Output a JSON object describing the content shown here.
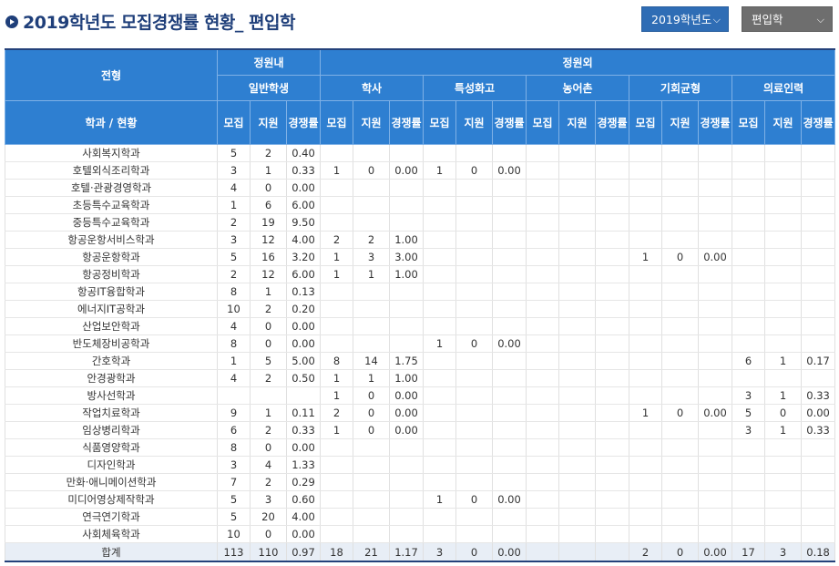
{
  "title": "2019학년도 모집경쟁률 현황_ 편입학",
  "year_select": {
    "value": "2019학년도"
  },
  "type_select": {
    "value": "편입학"
  },
  "header": {
    "jeonhyeong": "전형",
    "jeongwonnae": "정원내",
    "jeongwonoe": "정원외",
    "groups": [
      "일반학생",
      "학사",
      "특성화고",
      "농어촌",
      "기회균형",
      "의료인력"
    ],
    "dept_col": "학과 / 현황",
    "sub_mojip": "모집",
    "sub_jiwon": "지원",
    "sub_rate": "경쟁률"
  },
  "rows": [
    [
      "사회복지학과",
      "5",
      "2",
      "0.40",
      "",
      "",
      "",
      "",
      "",
      "",
      "",
      "",
      "",
      "",
      "",
      "",
      "",
      "",
      ""
    ],
    [
      "호텔외식조리학과",
      "3",
      "1",
      "0.33",
      "1",
      "0",
      "0.00",
      "1",
      "0",
      "0.00",
      "",
      "",
      "",
      "",
      "",
      "",
      "",
      "",
      ""
    ],
    [
      "호텔·관광경영학과",
      "4",
      "0",
      "0.00",
      "",
      "",
      "",
      "",
      "",
      "",
      "",
      "",
      "",
      "",
      "",
      "",
      "",
      "",
      ""
    ],
    [
      "초등특수교육학과",
      "1",
      "6",
      "6.00",
      "",
      "",
      "",
      "",
      "",
      "",
      "",
      "",
      "",
      "",
      "",
      "",
      "",
      "",
      ""
    ],
    [
      "중등특수교육학과",
      "2",
      "19",
      "9.50",
      "",
      "",
      "",
      "",
      "",
      "",
      "",
      "",
      "",
      "",
      "",
      "",
      "",
      "",
      ""
    ],
    [
      "항공운항서비스학과",
      "3",
      "12",
      "4.00",
      "2",
      "2",
      "1.00",
      "",
      "",
      "",
      "",
      "",
      "",
      "",
      "",
      "",
      "",
      "",
      ""
    ],
    [
      "항공운항학과",
      "5",
      "16",
      "3.20",
      "1",
      "3",
      "3.00",
      "",
      "",
      "",
      "",
      "",
      "",
      "1",
      "0",
      "0.00",
      "",
      "",
      ""
    ],
    [
      "항공정비학과",
      "2",
      "12",
      "6.00",
      "1",
      "1",
      "1.00",
      "",
      "",
      "",
      "",
      "",
      "",
      "",
      "",
      "",
      "",
      "",
      ""
    ],
    [
      "항공IT융합학과",
      "8",
      "1",
      "0.13",
      "",
      "",
      "",
      "",
      "",
      "",
      "",
      "",
      "",
      "",
      "",
      "",
      "",
      "",
      ""
    ],
    [
      "에너지IT공학과",
      "10",
      "2",
      "0.20",
      "",
      "",
      "",
      "",
      "",
      "",
      "",
      "",
      "",
      "",
      "",
      "",
      "",
      "",
      ""
    ],
    [
      "산업보안학과",
      "4",
      "0",
      "0.00",
      "",
      "",
      "",
      "",
      "",
      "",
      "",
      "",
      "",
      "",
      "",
      "",
      "",
      "",
      ""
    ],
    [
      "반도체장비공학과",
      "8",
      "0",
      "0.00",
      "",
      "",
      "",
      "1",
      "0",
      "0.00",
      "",
      "",
      "",
      "",
      "",
      "",
      "",
      "",
      ""
    ],
    [
      "간호학과",
      "1",
      "5",
      "5.00",
      "8",
      "14",
      "1.75",
      "",
      "",
      "",
      "",
      "",
      "",
      "",
      "",
      "",
      "6",
      "1",
      "0.17"
    ],
    [
      "안경광학과",
      "4",
      "2",
      "0.50",
      "1",
      "1",
      "1.00",
      "",
      "",
      "",
      "",
      "",
      "",
      "",
      "",
      "",
      "",
      "",
      ""
    ],
    [
      "방사선학과",
      "",
      "",
      "",
      "1",
      "0",
      "0.00",
      "",
      "",
      "",
      "",
      "",
      "",
      "",
      "",
      "",
      "3",
      "1",
      "0.33"
    ],
    [
      "작업치료학과",
      "9",
      "1",
      "0.11",
      "2",
      "0",
      "0.00",
      "",
      "",
      "",
      "",
      "",
      "",
      "1",
      "0",
      "0.00",
      "5",
      "0",
      "0.00"
    ],
    [
      "임상병리학과",
      "6",
      "2",
      "0.33",
      "1",
      "0",
      "0.00",
      "",
      "",
      "",
      "",
      "",
      "",
      "",
      "",
      "",
      "3",
      "1",
      "0.33"
    ],
    [
      "식품영양학과",
      "8",
      "0",
      "0.00",
      "",
      "",
      "",
      "",
      "",
      "",
      "",
      "",
      "",
      "",
      "",
      "",
      "",
      "",
      ""
    ],
    [
      "디자인학과",
      "3",
      "4",
      "1.33",
      "",
      "",
      "",
      "",
      "",
      "",
      "",
      "",
      "",
      "",
      "",
      "",
      "",
      "",
      ""
    ],
    [
      "만화·애니메이션학과",
      "7",
      "2",
      "0.29",
      "",
      "",
      "",
      "",
      "",
      "",
      "",
      "",
      "",
      "",
      "",
      "",
      "",
      "",
      ""
    ],
    [
      "미디어영상제작학과",
      "5",
      "3",
      "0.60",
      "",
      "",
      "",
      "1",
      "0",
      "0.00",
      "",
      "",
      "",
      "",
      "",
      "",
      "",
      "",
      ""
    ],
    [
      "연극연기학과",
      "5",
      "20",
      "4.00",
      "",
      "",
      "",
      "",
      "",
      "",
      "",
      "",
      "",
      "",
      "",
      "",
      "",
      "",
      ""
    ],
    [
      "사회체육학과",
      "10",
      "0",
      "0.00",
      "",
      "",
      "",
      "",
      "",
      "",
      "",
      "",
      "",
      "",
      "",
      "",
      "",
      "",
      ""
    ]
  ],
  "total": [
    "합계",
    "113",
    "110",
    "0.97",
    "18",
    "21",
    "1.17",
    "3",
    "0",
    "0.00",
    "",
    "",
    "",
    "2",
    "0",
    "0.00",
    "17",
    "3",
    "0.18"
  ],
  "colors": {
    "header_bg": "#2e7fd1",
    "title": "#1f3f7a",
    "year_select_bg": "#2f6db5",
    "type_select_bg": "#6e6e6e"
  },
  "icons": [
    "play-circle-icon",
    "chevron-down-icon"
  ]
}
